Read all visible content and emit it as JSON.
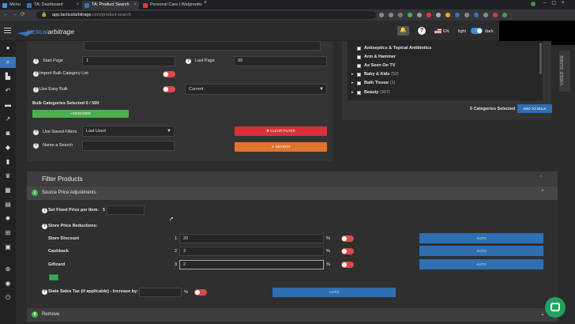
{
  "browser": {
    "tabs": [
      {
        "label": "Menu"
      },
      {
        "label": "TA: Dashboard"
      },
      {
        "label": "TA: Product Search"
      },
      {
        "label": "Personal Care | Walgreens"
      }
    ],
    "url_host": "app.tacticalarbitrage",
    "url_rest": ".com/product-search"
  },
  "header": {
    "logo_a": "tactical",
    "logo_b": "arbitrage",
    "lang": "EN",
    "theme_light": "light",
    "theme_dark": "dark"
  },
  "search_form": {
    "start_page_label": "Start Page",
    "start_page_value": "1",
    "last_page_label": "Last Page",
    "last_page_value": "99",
    "import_bulk_label": "Import Bulk Category List",
    "use_easy_bulk_label": "Use Easy Bulk",
    "easy_bulk_select": "Current",
    "bulk_selected": "Bulk Categories Selected 0 / 500",
    "manager_button": "MANAGER",
    "use_saved_filters_label": "Use Saved Filters",
    "saved_filters_select": "Last Used",
    "name_search_label": "Name a Search",
    "clear_filter_button": "CLEAR FILTER",
    "search_button": "SEARCH"
  },
  "categories": {
    "items": [
      {
        "label": "Antiseptics & Topical Antibiotics",
        "expand": false
      },
      {
        "label": "Arm & Hammer",
        "expand": false
      },
      {
        "label": "As Seen On TV",
        "expand": false
      },
      {
        "label": "Baby & Kids",
        "count": "(52)",
        "expand": true
      },
      {
        "label": "Bath Tissue",
        "count": "(1)",
        "expand": true
      },
      {
        "label": "Beauty",
        "count": "(307)",
        "expand": true
      }
    ],
    "selected_text": "0 Categories Selected",
    "add_to_bulk": "ADD TO BULK",
    "video_guide": "VIDEO GUIDE"
  },
  "filter": {
    "title": "Filter Products",
    "section1_number": "1",
    "section1_title": "Source Price Adjustments",
    "fixed_price_label": "Set Fixed Price per Item:",
    "currency": "$",
    "reductions_label": "Store Price Reductions:",
    "rows": [
      {
        "label": "Store Discount",
        "num": "1",
        "value": "20",
        "unit": "%",
        "auto": "AUTO"
      },
      {
        "label": "Cashback",
        "num": "2",
        "value": "3",
        "unit": "%",
        "auto": "AUTO"
      },
      {
        "label": "Giftcard",
        "num": "3",
        "value": "2",
        "unit": "%",
        "auto": "AUTO"
      }
    ],
    "sales_tax_label": "State Sales Tax (if applicable) - Increase by:",
    "sales_tax_unit": "%",
    "sales_tax_auto": "AUTO",
    "section2_number": "9",
    "section2_title": "Remove"
  },
  "colors": {
    "accent": "#3a73b6",
    "danger": "#d94a4a",
    "search": "#e0742a",
    "success": "#4caf50"
  }
}
